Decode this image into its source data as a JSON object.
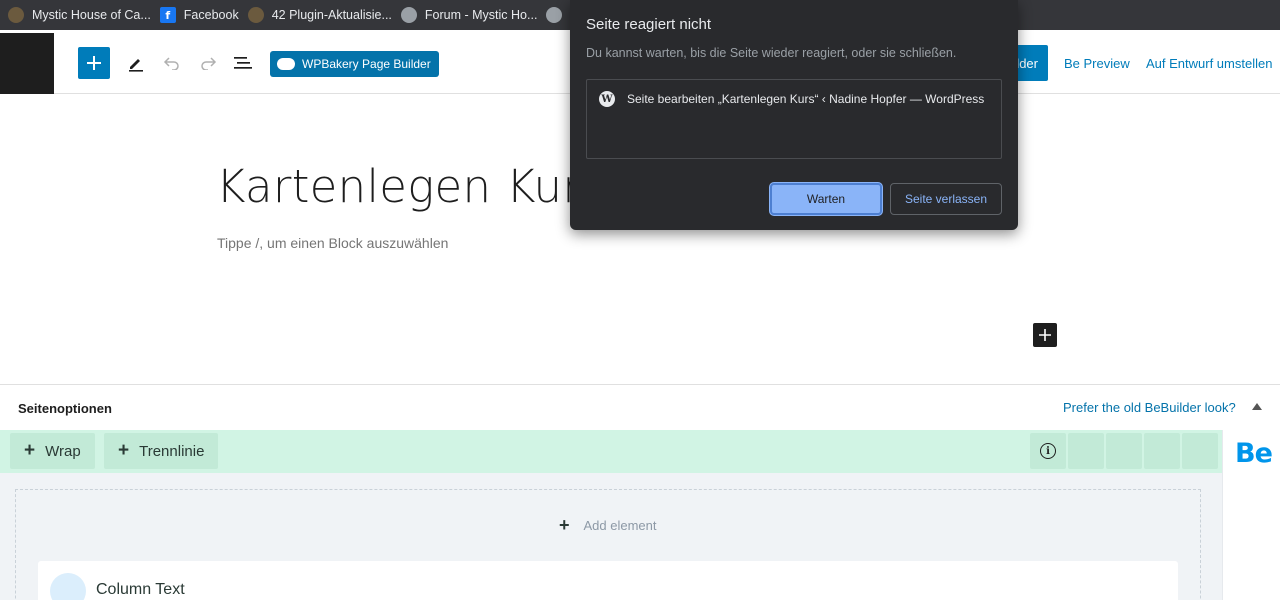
{
  "bookmarks": [
    {
      "label": "Mystic House of Ca...",
      "icon": "site-avatar-icon"
    },
    {
      "label": "Facebook",
      "icon": "facebook-icon"
    },
    {
      "label": "42 Plugin-Aktualisie...",
      "icon": "site-avatar-icon"
    },
    {
      "label": "Forum - Mystic Ho...",
      "icon": "globe-icon"
    },
    {
      "label": "",
      "icon": "globe-icon"
    }
  ],
  "editor": {
    "wpbakery_label": "WPBakery Page Builder",
    "update_label": "lder",
    "preview_label": "Be Preview",
    "draft_label": "Auf Entwurf umstellen"
  },
  "content": {
    "title": "Kartenlegen Kurs",
    "placeholder": "Tippe /, um einen Block auszuwählen"
  },
  "options": {
    "title": "Seitenoptionen",
    "link": "Prefer the old BeBuilder look?"
  },
  "bebuilder": {
    "wrap_label": "Wrap",
    "divider_label": "Trennlinie",
    "logo": "Be",
    "add_element_label": "Add element",
    "column_label": "Column Text"
  },
  "dialog": {
    "title": "Seite reagiert nicht",
    "message": "Du kannst warten, bis die Seite wieder reagiert, oder sie schließen.",
    "page_entry": "Seite bearbeiten „Kartenlegen Kurs“ ‹ Nadine Hopfer — WordPress",
    "wait_label": "Warten",
    "leave_label": "Seite verlassen"
  },
  "colors": {
    "accent": "#007cba",
    "be_blue": "#0095eb",
    "bebar_bg": "#d1f4e4",
    "dialog_bg": "#292a2d"
  }
}
